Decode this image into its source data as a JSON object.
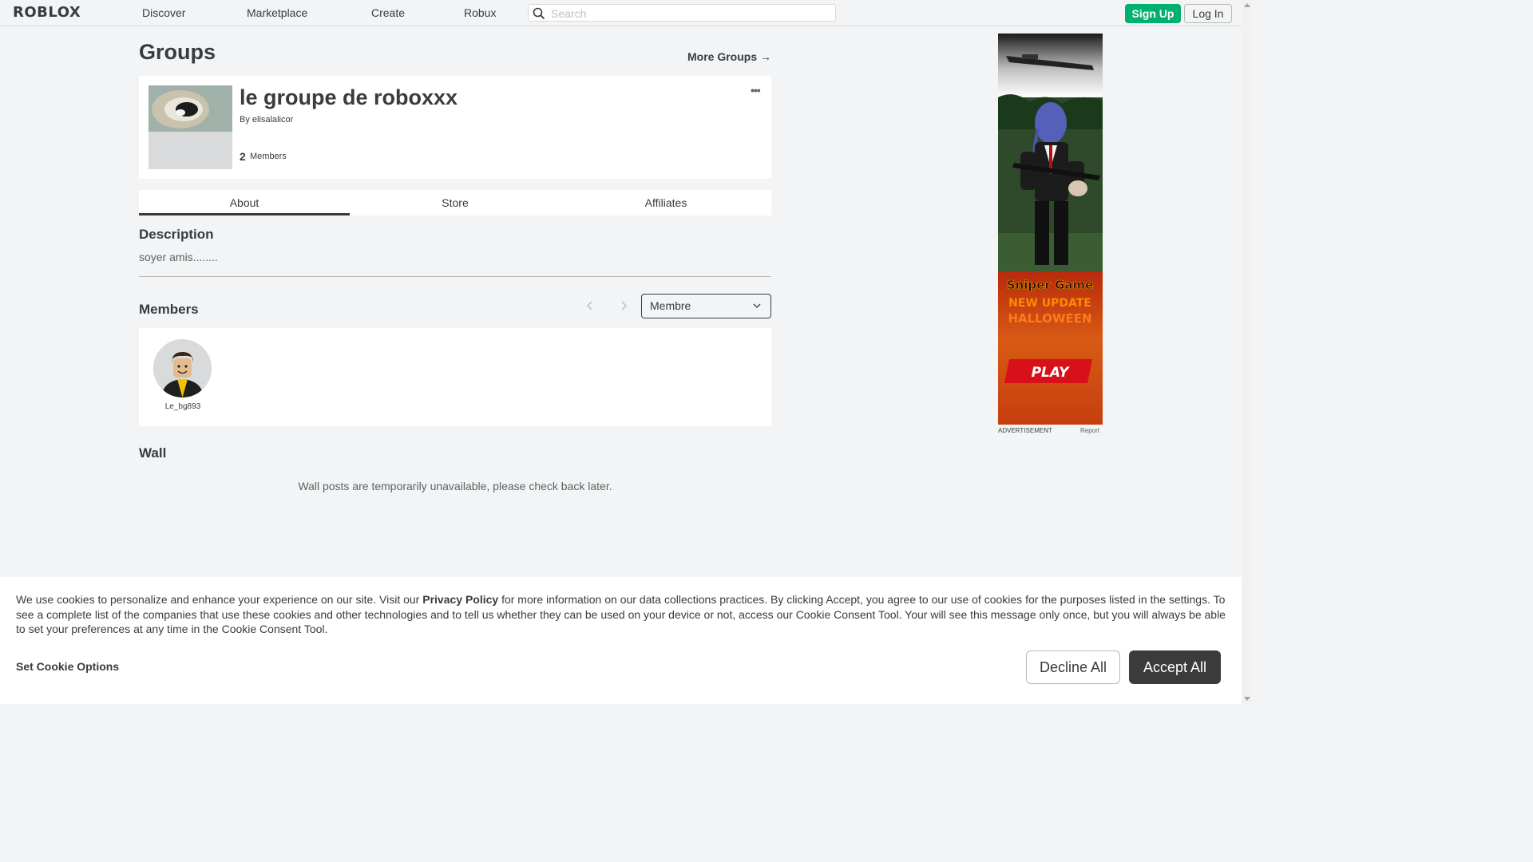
{
  "header": {
    "logo": "ROBLOX",
    "nav": [
      "Discover",
      "Marketplace",
      "Create",
      "Robux"
    ],
    "search_placeholder": "Search",
    "signup_label": "Sign Up",
    "login_label": "Log In"
  },
  "page": {
    "title": "Groups",
    "more_groups": "More Groups →"
  },
  "group": {
    "name": "le groupe de roboxxx",
    "by_prefix": "By",
    "owner": "elisalalicor",
    "member_count": "2",
    "member_count_label": "Members",
    "menu_icon": "ellipsis-icon"
  },
  "tabs": [
    "About",
    "Store",
    "Affiliates"
  ],
  "about": {
    "description_title": "Description",
    "description": "soyer amis........",
    "members_title": "Members",
    "role_selected": "Membre",
    "members": [
      {
        "username": "Le_bg893"
      }
    ],
    "wall_title": "Wall",
    "wall_message": "Wall posts are temporarily unavailable, please check back later."
  },
  "ad": {
    "label": "ADVERTISEMENT",
    "report": "Report",
    "headline": "Sniper Game",
    "subheadline": "NEW UPDATE",
    "event": "HALLOWEEN",
    "play": "PLAY"
  },
  "cookie": {
    "text_before": "We use cookies to personalize and enhance your experience on our site. Visit our ",
    "privacy_link": "Privacy Policy",
    "text_after": " for more information on our data collections practices. By clicking Accept, you agree to our use of cookies for the purposes listed in the settings. To see a complete list of the companies that use these cookies and other technologies and to tell us whether they can be used on your device or not, access our Cookie Consent Tool. Your will see this message only once, but you will always be able to set your preferences at any time in the Cookie Consent Tool.",
    "set_options": "Set Cookie Options",
    "decline": "Decline All",
    "accept": "Accept All"
  },
  "colors": {
    "accent_green": "#00b06f",
    "text_dark": "#393b3d",
    "page_bg": "#f2f4f5"
  }
}
